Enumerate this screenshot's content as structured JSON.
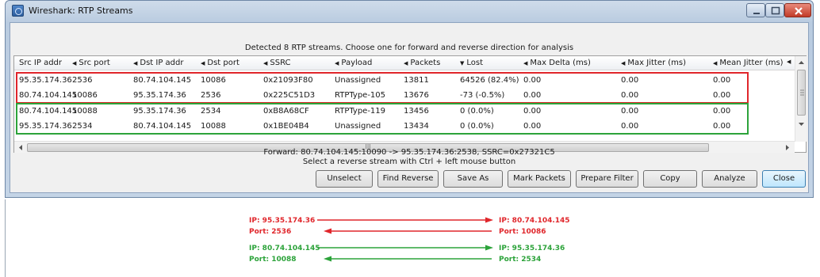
{
  "window": {
    "title": "Wireshark: RTP Streams"
  },
  "header": {
    "text": "Detected 8 RTP streams. Choose one for forward and reverse direction for analysis"
  },
  "table": {
    "columns": [
      "Src IP addr",
      "Src port",
      "Dst IP addr",
      "Dst port",
      "SSRC",
      "Payload",
      "Packets",
      "Lost",
      "Max Delta (ms)",
      "Max Jitter (ms)",
      "Mean Jitter (ms)"
    ],
    "sort_glyph": "◀",
    "lost_sort_glyph": "▼",
    "rows": [
      [
        "95.35.174.36",
        "2536",
        "80.74.104.145",
        "10086",
        "0x21093F80",
        "Unassigned",
        "13811",
        "64526 (82.4%)",
        "0.00",
        "0.00",
        "0.00"
      ],
      [
        "80.74.104.145",
        "10086",
        "95.35.174.36",
        "2536",
        "0x225C51D3",
        "RTPType-105",
        "13676",
        "-73 (-0.5%)",
        "0.00",
        "0.00",
        "0.00"
      ],
      [
        "80.74.104.145",
        "10088",
        "95.35.174.36",
        "2534",
        "0xB8A68CF",
        "RTPType-119",
        "13456",
        "0 (0.0%)",
        "0.00",
        "0.00",
        "0.00"
      ],
      [
        "95.35.174.36",
        "2534",
        "80.74.104.145",
        "10088",
        "0x1BE04B4",
        "Unassigned",
        "13434",
        "0 (0.0%)",
        "0.00",
        "0.00",
        "0.00"
      ]
    ],
    "hscroll_glyph": "III"
  },
  "status": {
    "forward": "Forward: 80.74.104.145:10090 -> 95.35.174.36:2538, SSRC=0x27321C5",
    "hint": "Select a reverse stream with Ctrl + left mouse button"
  },
  "buttons": [
    "Unselect",
    "Find Reverse",
    "Save As",
    "Mark Packets",
    "Prepare Filter",
    "Copy",
    "Analyze",
    "Close"
  ],
  "diagram": {
    "red": {
      "left_ip": "IP: 95.35.174.36",
      "left_port": "Port: 2536",
      "right_ip": "IP: 80.74.104.145",
      "right_port": "Port: 10086",
      "color": "#e0262b"
    },
    "green": {
      "left_ip": "IP: 80.74.104.145",
      "left_port": "Port: 10088",
      "right_ip": "IP: 95.35.174.36",
      "right_port": "Port: 2534",
      "color": "#2ca33a"
    }
  }
}
